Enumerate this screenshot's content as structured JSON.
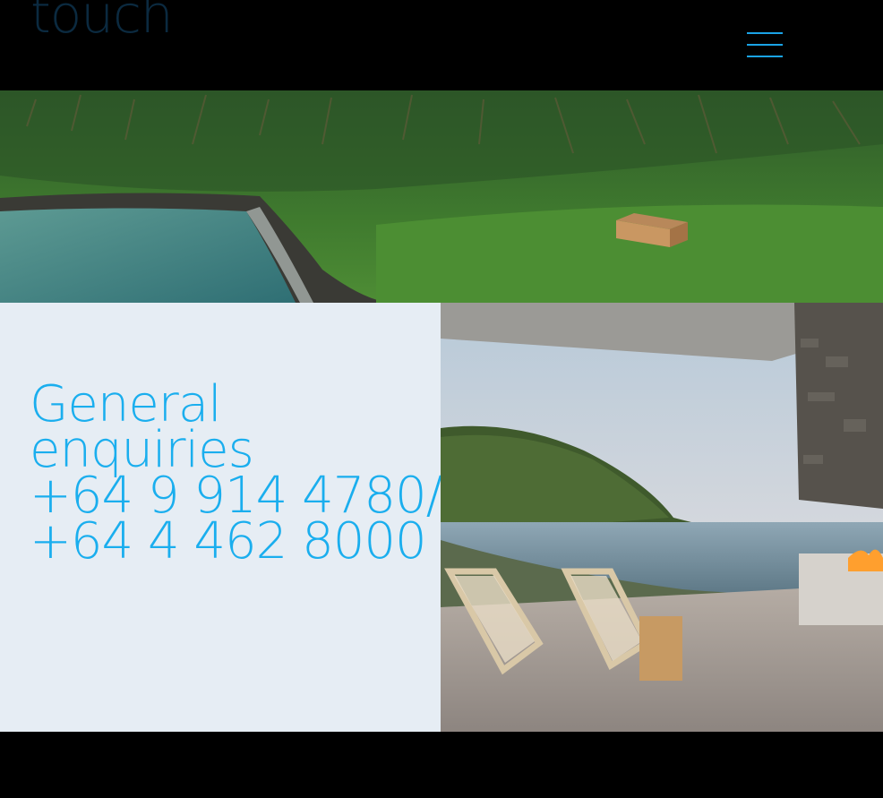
{
  "header": {
    "logo_text": "touch",
    "menu_icon": "hamburger-icon"
  },
  "contact": {
    "heading_line1": "General",
    "heading_line2": "enquiries",
    "phone_line1": "+64 9 914 4780/",
    "phone_line2": "+64 4 462 8000"
  },
  "colors": {
    "accent": "#1aaeee",
    "panel_bg": "#e6edf4",
    "header_bg": "#000000",
    "logo": "#0b2a40"
  }
}
